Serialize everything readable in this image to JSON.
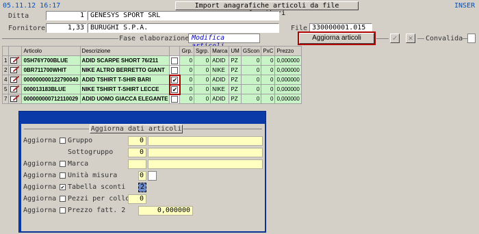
{
  "header": {
    "datetime": "05.11.12 16:17",
    "mode": "INSER",
    "import_button": "Import anagrafiche articoli da file fornitori",
    "ditta_label": "Ditta",
    "ditta_code": "1",
    "ditta_name": "GENESYS SPORT SRL",
    "fornitore_label": "Fornitore",
    "fornitore_code": "1,33",
    "fornitore_name": "BURUGHI S.P.A.",
    "file_label": "File",
    "file_value": "330000001.015",
    "fase_label": "Fase elaborazione",
    "fase_value": "Modifica articoli",
    "aggiorna_button": "Aggiorna articoli",
    "convalida_label": "Convalida"
  },
  "grid": {
    "headers": [
      "Articolo",
      "Descrizione",
      "",
      "Grp.",
      "Sgrp.",
      "Marca",
      "UM",
      "GScon",
      "PxC",
      "Prezzo"
    ],
    "rows": [
      {
        "n": "1",
        "articolo": "0SH76Y700BLUE",
        "descrizione": "ADID SCARPE  SHORT 76/211",
        "checked": "",
        "grp": "0",
        "sgrp": "0",
        "marca": "ADID",
        "um": "PZ",
        "gscon": "0",
        "pxc": "0",
        "prezzo": "0,000000"
      },
      {
        "n": "2",
        "articolo": "0BR711700WHIT",
        "descrizione": "NIKE ALTRO    BERRETTO GIANT",
        "checked": "",
        "grp": "0",
        "sgrp": "0",
        "marca": "NIKE",
        "um": "PZ",
        "gscon": "0",
        "pxc": "0",
        "prezzo": "0,000000"
      },
      {
        "n": "4",
        "articolo": "000000000122790040",
        "descrizione": "ADID TSHIRT   T-SHIR BARI",
        "checked": "✔",
        "grp": "0",
        "sgrp": "0",
        "marca": "ADID",
        "um": "PZ",
        "gscon": "0",
        "pxc": "0",
        "prezzo": "0,000000"
      },
      {
        "n": "5",
        "articolo": "000013183BLUE",
        "descrizione": "NIKE TSHIRT   T-SHIRT LECCE",
        "checked": "✔",
        "grp": "0",
        "sgrp": "0",
        "marca": "NIKE",
        "um": "PZ",
        "gscon": "0",
        "pxc": "0",
        "prezzo": "0,000000"
      },
      {
        "n": "7",
        "articolo": "000000000712110029",
        "descrizione": "ADID UOMO     GIACCA ELEGANTE",
        "checked": "",
        "grp": "0",
        "sgrp": "0",
        "marca": "ADID",
        "um": "PZ",
        "gscon": "0",
        "pxc": "0",
        "prezzo": "0,000000"
      }
    ]
  },
  "dialog": {
    "title": "Aggiorna dati articoli",
    "aggiorna": "Aggiorna",
    "gruppo_label": "Gruppo",
    "gruppo_value": "0",
    "sottogruppo_label": "Sottogruppo",
    "sottogruppo_value": "0",
    "marca_label": "Marca",
    "unita_label": "Unità misura",
    "unita_value": "0",
    "sconti_label": "Tabella sconti",
    "sconti_value": "2",
    "pezzi_label": "Pezzi per collo",
    "pezzi_value": "0",
    "prezzo_label": "Prezzo fatt. 2",
    "prezzo_value": "0,000000",
    "sconti_checked": "✔"
  }
}
